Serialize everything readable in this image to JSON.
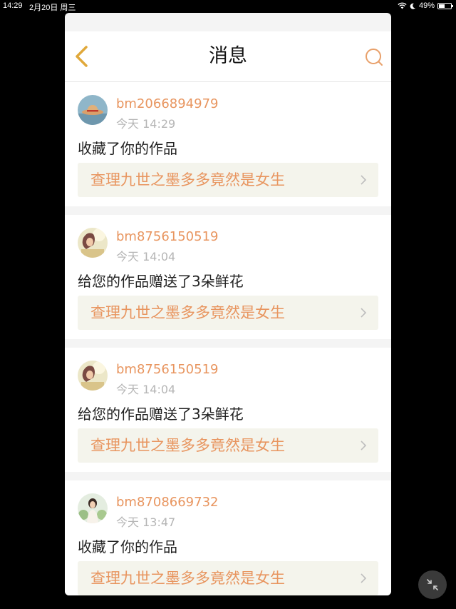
{
  "status_bar": {
    "time": "14:29",
    "date": "2月20日 周三",
    "battery_percent": "49%",
    "battery_level": 0.49
  },
  "header": {
    "title": "消息",
    "back_icon": "chevron-left-icon",
    "search_icon": "search-icon"
  },
  "colors": {
    "accent": "#e8955f",
    "time_text": "#b5b5b5",
    "work_box_bg": "#f4f4ec"
  },
  "messages": [
    {
      "username": "bm2066894979",
      "time": "今天 14:29",
      "action": "收藏了你的作品",
      "work_title": "查理九世之墨多多竟然是女生",
      "avatar": "avatar-hat"
    },
    {
      "username": "bm8756150519",
      "time": "今天 14:04",
      "action": "给您的作品赠送了3朵鲜花",
      "work_title": "查理九世之墨多多竟然是女生",
      "avatar": "avatar-girl"
    },
    {
      "username": "bm8756150519",
      "time": "今天 14:04",
      "action": "给您的作品赠送了3朵鲜花",
      "work_title": "查理九世之墨多多竟然是女生",
      "avatar": "avatar-girl"
    },
    {
      "username": "bm8708669732",
      "time": "今天 13:47",
      "action": "收藏了你的作品",
      "work_title": "查理九世之墨多多竟然是女生",
      "avatar": "avatar-photo"
    }
  ],
  "floating_button": {
    "icon": "minimize-icon"
  }
}
